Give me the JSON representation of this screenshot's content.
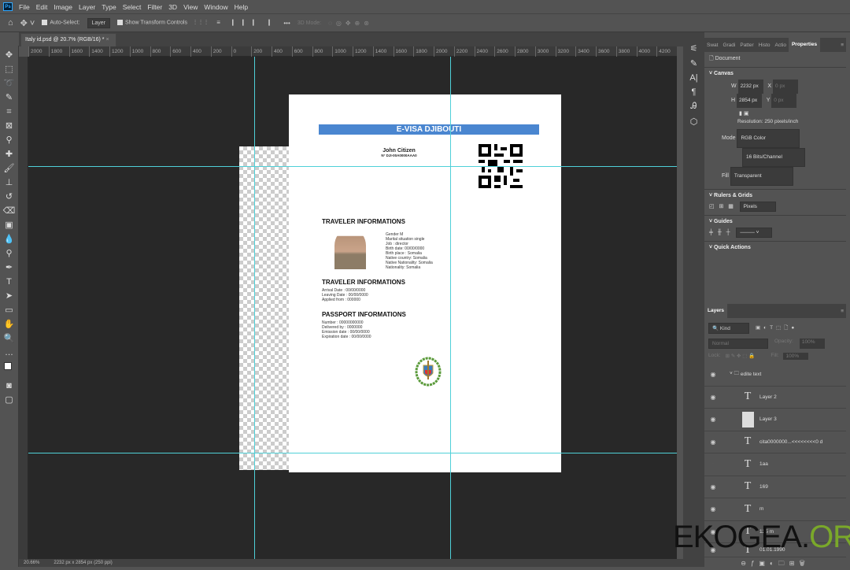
{
  "menu": [
    "File",
    "Edit",
    "Image",
    "Layer",
    "Type",
    "Select",
    "Filter",
    "3D",
    "View",
    "Window",
    "Help"
  ],
  "options": {
    "auto_select": "Auto-Select:",
    "layer_select": "Layer",
    "show_transform": "Show Transform Controls",
    "mode_3d": "3D Mode:",
    "more": "•••"
  },
  "doc_tab": {
    "title": "Italy id.psd @ 20.7% (RGB/16) *",
    "close": "×"
  },
  "ruler": [
    "2000",
    "1800",
    "1600",
    "1400",
    "1200",
    "1000",
    "800",
    "600",
    "400",
    "200",
    "0",
    "200",
    "400",
    "600",
    "800",
    "1000",
    "1200",
    "1400",
    "1600",
    "1800",
    "2000",
    "2200",
    "2400",
    "2600",
    "2800",
    "3000",
    "3200",
    "3400",
    "3600",
    "3800",
    "4000",
    "4200"
  ],
  "status": {
    "zoom": "20.66%",
    "info": "2232 px x 2854 px (250 ppi)"
  },
  "document": {
    "banner": "E-VISA DJIBOUTI",
    "name": "John Citizen",
    "number": "N° DJI-00A0000AAA0",
    "sec1": "TRAVELER INFORMATIONS",
    "details": [
      "Gender M",
      "Marital situation single",
      "Job : director",
      "Birth date: 00/00/0000",
      "Birth place : Somalia",
      "Native country: Somalia",
      "Native Nationality: Somalia",
      "Nationality: Somalia"
    ],
    "sec2": "TRAVELER INFORMATIONS",
    "travel": [
      "Arrival Date : 00/00/0000",
      "Leaving Date : 00/00/0000",
      "Applied from : 000000"
    ],
    "sec3": "PASSPORT INFORMATIONS",
    "passport": [
      "Number : 00000000000",
      "Delivered by : 0000000",
      "Emission date : 00/00/0000",
      "Expiration date : 00/00/0000"
    ],
    "banner_color": "#4a86d0"
  },
  "properties": {
    "tabs": [
      "Swat",
      "Gradi",
      "Patter",
      "Histo",
      "Actio",
      "Properties"
    ],
    "document": "Document",
    "canvas": "Canvas",
    "w_label": "W",
    "w": "2232 px",
    "h_label": "H",
    "h": "2854 px",
    "x_label": "X",
    "x": "0 px",
    "y_label": "Y",
    "y": "0 px",
    "resolution": "Resolution: 250 pixels/inch",
    "mode_label": "Mode",
    "mode": "RGB Color",
    "depth": "16 Bits/Channel",
    "fill_label": "Fill",
    "fill": "Transparent",
    "rulers": "Rulers & Grids",
    "units": "Pixels",
    "guides": "Guides",
    "quick": "Quick Actions"
  },
  "layers": {
    "tab": "Layers",
    "kind": "Kind",
    "blend": "Normal",
    "opacity_label": "Opacity:",
    "opacity": "100%",
    "lock_label": "Lock:",
    "fill_label": "Fill:",
    "fill": "100%",
    "group": "edite text",
    "items": [
      "Layer 2",
      "Layer 3",
      "cita0000000...<<<<<<<<0 d",
      "1aa",
      "169",
      "m",
      "125 m",
      "01.01.1990"
    ]
  },
  "watermark": {
    "a": "EKOGEA.",
    "b": "ORG"
  }
}
